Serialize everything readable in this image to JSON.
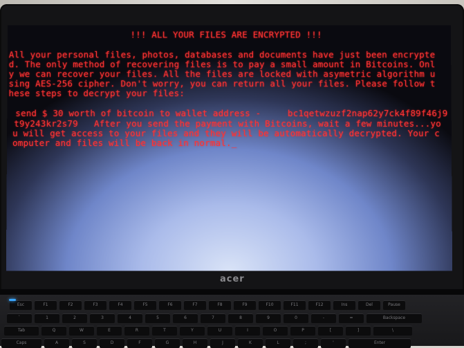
{
  "photo": {
    "description_role": "photo of laptop displaying ransomware message"
  },
  "screen": {
    "title": "!!! ALL YOUR FILES ARE ENCRYPTED !!!",
    "lines": [
      "All your personal files, photos, databases and documents have just been encrypte",
      "d. The only method of recovering files is to pay a small amount in Bitcoins. Onl",
      "y we can recover your files. All the files are locked with asymetric algorithm u",
      "sing AES-256 cipher. Don't worry, you can return all your files. Please follow t",
      "hese steps to decrypt your files:",
      "",
      "send $ 30 worth of bitcoin to wallet address -     bc1qetwzuzf2nap62y7ck4f89f46j9",
      "t9y243kr2s79   After you send the payment with Bitcoins, wait a few minutes...yo",
      "u will get access to your files and they will be automatically decrypted. Your c",
      "omputer and files will be back in normal._"
    ]
  },
  "brand": "acer",
  "keyboard": {
    "row1": [
      "Esc",
      "F1",
      "F2",
      "F3",
      "F4",
      "F5",
      "F6",
      "F7",
      "F8",
      "F9",
      "F10",
      "F11",
      "F12",
      "Ins",
      "Del",
      "Pause"
    ],
    "row2": [
      "`",
      "1",
      "2",
      "3",
      "4",
      "5",
      "6",
      "7",
      "8",
      "9",
      "0",
      "-",
      "=",
      "Backspace"
    ],
    "row3": [
      "Tab",
      "Q",
      "W",
      "E",
      "R",
      "T",
      "Y",
      "U",
      "I",
      "O",
      "P",
      "[",
      "]",
      "\\"
    ],
    "row4": [
      "Caps",
      "A",
      "S",
      "D",
      "F",
      "G",
      "H",
      "J",
      "K",
      "L",
      ";",
      "'",
      "Enter"
    ]
  },
  "colors": {
    "message_text": "#ff3333",
    "bezel": "#141416",
    "screen_glow": "#aabbea"
  }
}
